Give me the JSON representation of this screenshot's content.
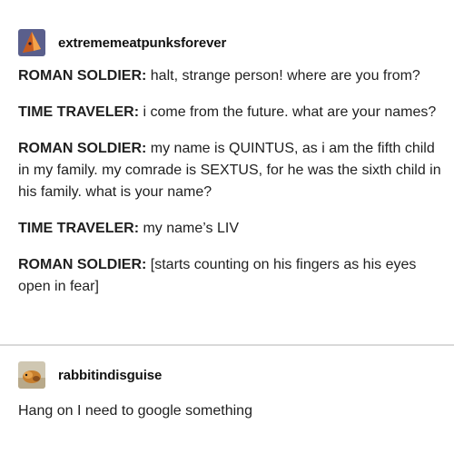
{
  "posts": [
    {
      "username": "extrememeatpunksforever",
      "avatar_icon": "pyramid-icon",
      "dialogue": [
        {
          "speaker": "ROMAN SOLDIER:",
          "text": " halt, strange person! where are you from?"
        },
        {
          "speaker": "TIME TRAVELER:",
          "text": " i come from the future. what are your names?"
        },
        {
          "speaker": "ROMAN SOLDIER:",
          "text": " my name is QUINTUS, as i am the fifth child in my family. my comrade is SEXTUS, for he was the sixth child in his family. what is your name?"
        },
        {
          "speaker": "TIME TRAVELER:",
          "text": " my name’s LIV"
        },
        {
          "speaker": "ROMAN SOLDIER:",
          "text": " [starts counting on his fingers as his eyes open in fear]"
        }
      ]
    },
    {
      "username": "rabbitindisguise",
      "avatar_icon": "bunny-photo-icon",
      "text": "Hang on I need to google something"
    }
  ],
  "colors": {
    "divider": "#d9d9d9",
    "text": "#1f1f1f",
    "avatar1_bg": "#5a5f8c",
    "avatar1_shape": "#e87a2c",
    "avatar2_bg": "#cfc7b2"
  }
}
